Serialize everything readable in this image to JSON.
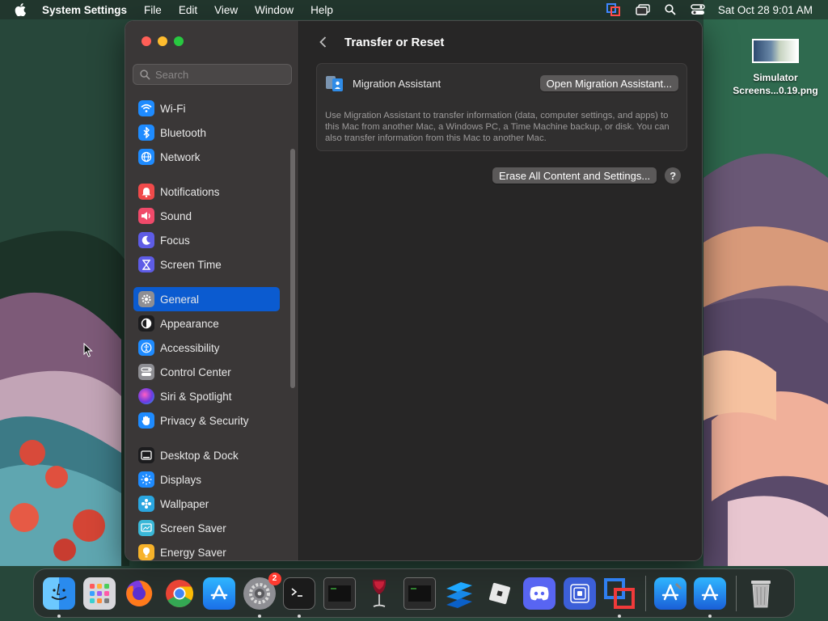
{
  "menubar": {
    "app_name": "System Settings",
    "menus": [
      "File",
      "Edit",
      "View",
      "Window",
      "Help"
    ],
    "clock": "Sat Oct 28  9:01 AM"
  },
  "desktop": {
    "file_line1": "Simulator",
    "file_line2": "Screens...0.19.png"
  },
  "sidebar": {
    "search_placeholder": "Search",
    "groups": [
      [
        {
          "label": "Wi-Fi",
          "icon": "wifi-icon",
          "color": "#1e8bff"
        },
        {
          "label": "Bluetooth",
          "icon": "bluetooth-icon",
          "color": "#1e8bff"
        },
        {
          "label": "Network",
          "icon": "globe-icon",
          "color": "#1e8bff"
        }
      ],
      [
        {
          "label": "Notifications",
          "icon": "bell-icon",
          "color": "#f04a4a"
        },
        {
          "label": "Sound",
          "icon": "speaker-icon",
          "color": "#f04a6a"
        },
        {
          "label": "Focus",
          "icon": "moon-icon",
          "color": "#5e5ce6"
        },
        {
          "label": "Screen Time",
          "icon": "hourglass-icon",
          "color": "#5e5ce6"
        }
      ],
      [
        {
          "label": "General",
          "icon": "gear-icon",
          "color": "#8e8e93",
          "active": true
        },
        {
          "label": "Appearance",
          "icon": "appearance-icon",
          "color": "#1c1c1e"
        },
        {
          "label": "Accessibility",
          "icon": "accessibility-icon",
          "color": "#1e8bff"
        },
        {
          "label": "Control Center",
          "icon": "control-center-icon",
          "color": "#8e8e93"
        },
        {
          "label": "Siri & Spotlight",
          "icon": "siri-icon",
          "color": "#b04ad8"
        },
        {
          "label": "Privacy & Security",
          "icon": "hand-icon",
          "color": "#1e8bff"
        }
      ],
      [
        {
          "label": "Desktop & Dock",
          "icon": "dock-icon",
          "color": "#1c1c1e"
        },
        {
          "label": "Displays",
          "icon": "display-icon",
          "color": "#1e8bff"
        },
        {
          "label": "Wallpaper",
          "icon": "wallpaper-icon",
          "color": "#2aa6e0"
        },
        {
          "label": "Screen Saver",
          "icon": "screensaver-icon",
          "color": "#3ab8d8"
        },
        {
          "label": "Energy Saver",
          "icon": "battery-icon",
          "color": "#f7b22a"
        }
      ]
    ]
  },
  "main": {
    "title": "Transfer or Reset",
    "migration": {
      "title": "Migration Assistant",
      "button": "Open Migration Assistant...",
      "description": "Use Migration Assistant to transfer information (data, computer settings, and apps) to this Mac from another Mac, a Windows PC, a Time Machine backup, or disk. You can also transfer information from this Mac to another Mac."
    },
    "erase_button": "Erase All Content and Settings...",
    "help_label": "?"
  },
  "dock": {
    "settings_badge": "2",
    "apps": [
      {
        "name": "finder-icon",
        "running": true
      },
      {
        "name": "launchpad-icon",
        "running": false
      },
      {
        "name": "firefox-icon",
        "running": false
      },
      {
        "name": "chrome-icon",
        "running": false
      },
      {
        "name": "app-store-icon",
        "running": false
      },
      {
        "name": "system-settings-icon",
        "running": true
      },
      {
        "name": "terminal-icon",
        "running": true
      },
      {
        "name": "console-icon-1",
        "running": false
      },
      {
        "name": "wine-icon",
        "running": false
      },
      {
        "name": "console-icon-2",
        "running": false
      },
      {
        "name": "stack-app-icon",
        "running": false
      },
      {
        "name": "roblox-icon",
        "running": false
      },
      {
        "name": "discord-icon",
        "running": false
      },
      {
        "name": "screen-app-icon",
        "running": false
      },
      {
        "name": "parallels-icon",
        "running": true
      },
      {
        "name": "xcode-icon",
        "running": false
      },
      {
        "name": "simulator-icon",
        "running": true
      },
      {
        "name": "trash-icon",
        "running": false
      }
    ]
  }
}
